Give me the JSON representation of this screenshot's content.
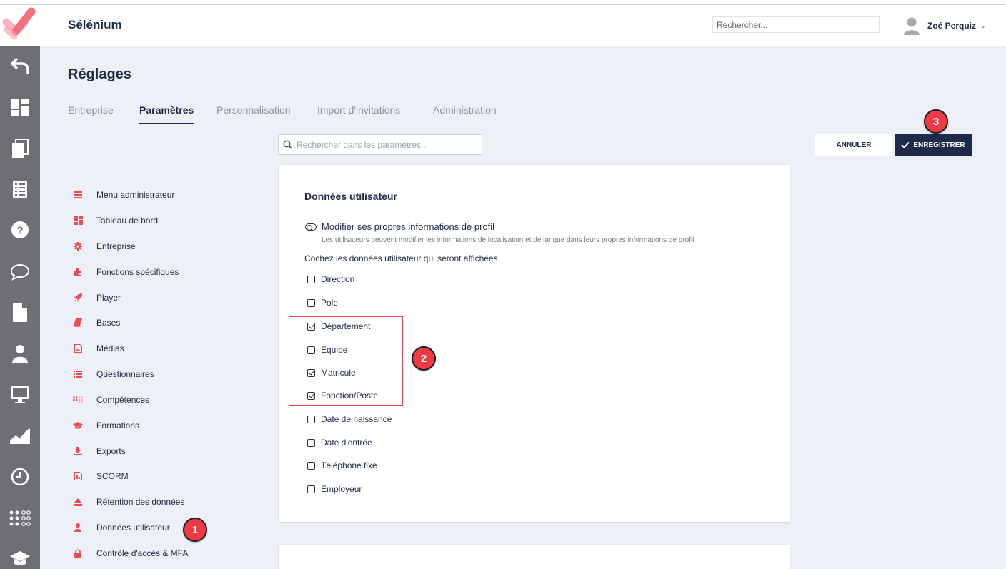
{
  "header": {
    "app_title": "Sélénium",
    "search_placeholder": "Rechercher...",
    "user_name": "Zoé Perquiz",
    "user_chevron": "⌄"
  },
  "left_rail": {
    "icons": [
      "back-icon",
      "dashboard-icon",
      "copy-icon",
      "list-icon",
      "help-icon",
      "chat-icon",
      "document-icon",
      "user-icon",
      "monitor-icon",
      "chart-icon",
      "clock-icon",
      "dots-icon",
      "graduation-icon"
    ]
  },
  "page": {
    "title": "Réglages",
    "tabs": [
      {
        "label": "Entreprise",
        "active": false
      },
      {
        "label": "Paramètres",
        "active": true
      },
      {
        "label": "Personnalisation",
        "active": false
      },
      {
        "label": "Import d'invitations",
        "active": false
      },
      {
        "label": "Administration",
        "active": false
      }
    ],
    "settings_search_placeholder": "Rechercher dans les paramètres...",
    "cancel_label": "ANNULER",
    "save_label": "ENREGISTRER"
  },
  "sidenav": {
    "items": [
      {
        "label": "Menu administrateur",
        "icon": "menu-icon"
      },
      {
        "label": "Tableau de bord",
        "icon": "dashboard-icon"
      },
      {
        "label": "Entreprise",
        "icon": "gear-icon"
      },
      {
        "label": "Fonctions spécifiques",
        "icon": "puzzle-icon"
      },
      {
        "label": "Player",
        "icon": "rocket-icon"
      },
      {
        "label": "Bases",
        "icon": "book-icon"
      },
      {
        "label": "Médias",
        "icon": "image-icon"
      },
      {
        "label": "Questionnaires",
        "icon": "list-icon"
      },
      {
        "label": "Compétences",
        "icon": "dots-icon"
      },
      {
        "label": "Formations",
        "icon": "graduation-icon"
      },
      {
        "label": "Exports",
        "icon": "download-icon"
      },
      {
        "label": "SCORM",
        "icon": "file-icon"
      },
      {
        "label": "Rétention des données",
        "icon": "eject-icon"
      },
      {
        "label": "Données utilisateur",
        "icon": "user-icon"
      },
      {
        "label": "Contrôle d'accès & MFA",
        "icon": "lock-icon"
      }
    ]
  },
  "card": {
    "title": "Données utilisateur",
    "toggle_label": "Modifier ses propres informations de profil",
    "toggle_help": "Les utilisateurs peuvent modifier les informations de localisation et de langue dans leurs propres informations de profil",
    "section_label": "Cochez les données utilisateur qui seront affichées",
    "fields": [
      {
        "label": "Direction",
        "checked": false
      },
      {
        "label": "Pole",
        "checked": false
      },
      {
        "label": "Département",
        "checked": true
      },
      {
        "label": "Equipe",
        "checked": false
      },
      {
        "label": "Matricule",
        "checked": true
      },
      {
        "label": "Fonction/Poste",
        "checked": true
      },
      {
        "label": "Date de naissance",
        "checked": false
      },
      {
        "label": "Date d'entrée",
        "checked": false
      },
      {
        "label": "Téléphone fixe",
        "checked": false
      },
      {
        "label": "Employeur",
        "checked": false
      }
    ]
  },
  "annotations": {
    "markers": [
      "1",
      "2",
      "3"
    ]
  },
  "colors": {
    "navy": "#1e2a4a",
    "accent_red": "#e5484d",
    "rail_grey": "#6e6f75",
    "page_bg": "#eef0f7"
  }
}
